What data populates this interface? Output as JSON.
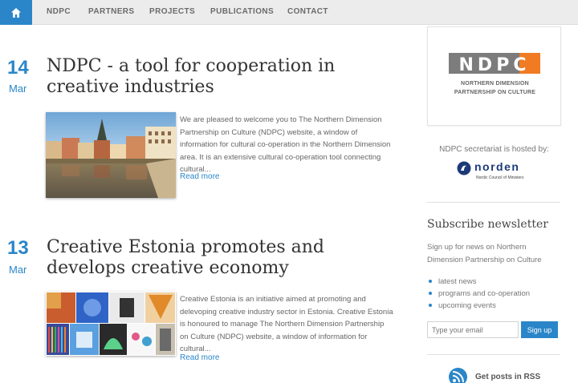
{
  "nav": {
    "home_icon": "home-icon",
    "items": [
      "NDPC",
      "PARTNERS",
      "PROJECTS",
      "PUBLICATIONS",
      "CONTACT"
    ]
  },
  "posts": [
    {
      "day": "14",
      "month": "Mar",
      "title": "NDPC - a tool for cooperation in creative industries",
      "excerpt": "We are pleased to welcome you to The Northern Dimension Partnership on Culture (NDPC) website, a window of information for cultural co-operation in the Northern Dimension area. It is an extensive cultural co-operation tool connecting cultural...",
      "read_more": "Read more"
    },
    {
      "day": "13",
      "month": "Mar",
      "title": "Creative Estonia promotes and develops creative economy",
      "excerpt": "Creative Estonia is an initiative aimed at promoting and delevoping creative industry sector in Estonia. Creative Estonia is honoured to manage The Northern Dimension Partnership on Culture (NDPC) website, a window of information for cultural...",
      "read_more": "Read more"
    }
  ],
  "sidebar": {
    "logo_text": "NDPC",
    "logo_subtitle_1": "NORTHERN DIMENSION",
    "logo_subtitle_2": "PARTNERSHIP ON CULTURE",
    "hosted_by": "NDPC secretariat is hosted by:",
    "norden_name": "norden",
    "norden_sub": "Nordic Council of Ministers",
    "newsletter": {
      "title": "Subscribe newsletter",
      "text": "Sign up for news on Northern Dimension Partnership on Culture",
      "items": [
        "latest news",
        "programs and co-operation",
        "upcoming events"
      ],
      "email_placeholder": "Type your email",
      "signup_label": "Sign up"
    },
    "rss": "Get posts in RSS"
  },
  "colors": {
    "accent": "#2a86c8",
    "logo_orange": "#f07b22",
    "logo_gray": "#7c7c7c"
  }
}
